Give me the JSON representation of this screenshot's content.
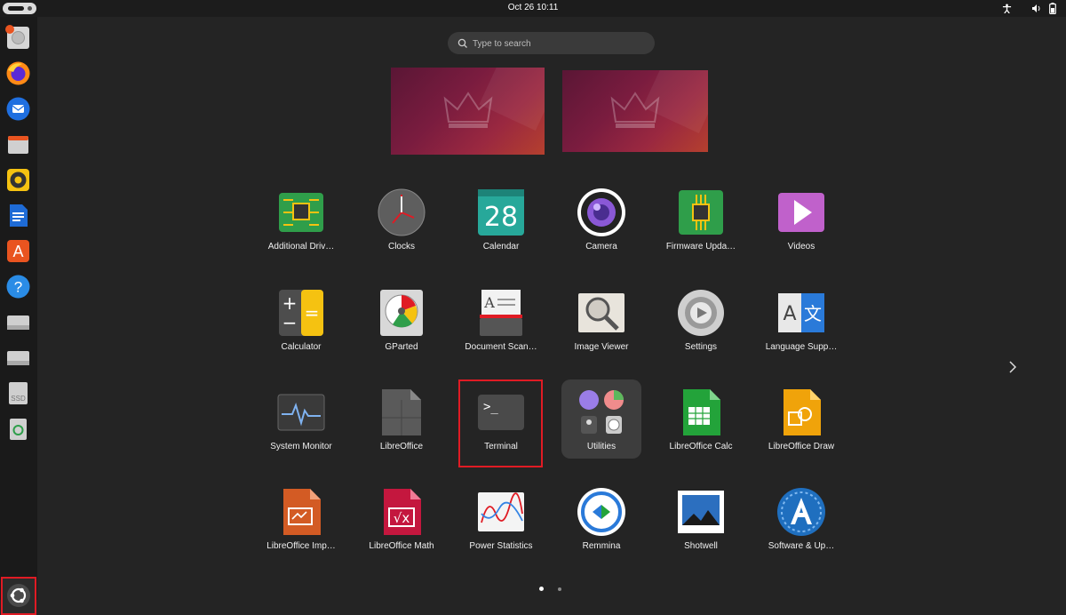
{
  "topbar": {
    "clock": "Oct 26  10:11"
  },
  "search": {
    "placeholder": "Type to search"
  },
  "apps": [
    {
      "label": "Additional Driv…",
      "icon": "chip-icon"
    },
    {
      "label": "Clocks",
      "icon": "clock-icon"
    },
    {
      "label": "Calendar",
      "icon": "calendar-icon",
      "day": "28"
    },
    {
      "label": "Camera",
      "icon": "camera-icon"
    },
    {
      "label": "Firmware Upda…",
      "icon": "chip-icon"
    },
    {
      "label": "Videos",
      "icon": "play-icon"
    },
    {
      "label": "Calculator",
      "icon": "calculator-icon"
    },
    {
      "label": "GParted",
      "icon": "disk-gauge-icon"
    },
    {
      "label": "Document Scan…",
      "icon": "scanner-icon"
    },
    {
      "label": "Image Viewer",
      "icon": "magnifier-icon"
    },
    {
      "label": "Settings",
      "icon": "gear-icon"
    },
    {
      "label": "Language Supp…",
      "icon": "language-icon"
    },
    {
      "label": "System Monitor",
      "icon": "pulse-icon"
    },
    {
      "label": "LibreOffice",
      "icon": "document-icon"
    },
    {
      "label": "Terminal",
      "icon": "terminal-icon",
      "prompt": ">_"
    },
    {
      "label": "Utilities",
      "icon": "folder-icon"
    },
    {
      "label": "LibreOffice Calc",
      "icon": "spreadsheet-icon"
    },
    {
      "label": "LibreOffice Draw",
      "icon": "draw-icon"
    },
    {
      "label": "LibreOffice Imp…",
      "icon": "presentation-icon"
    },
    {
      "label": "LibreOffice Math",
      "icon": "formula-icon",
      "glyph": "√x"
    },
    {
      "label": "Power Statistics",
      "icon": "graph-icon"
    },
    {
      "label": "Remmina",
      "icon": "remote-icon"
    },
    {
      "label": "Shotwell",
      "icon": "photo-icon"
    },
    {
      "label": "Software & Up…",
      "icon": "software-update-icon"
    }
  ],
  "calculator": {
    "plus": "+",
    "minus": "−",
    "equals": "="
  },
  "language": {
    "a": "A",
    "b": "文"
  },
  "scanner_letter": "A",
  "help_glyph": "?",
  "appstore_glyph": "A",
  "ssd_label": "SSD",
  "colors": {
    "accent": "#e95420",
    "highlight": "#e01b24",
    "background": "#242424"
  }
}
